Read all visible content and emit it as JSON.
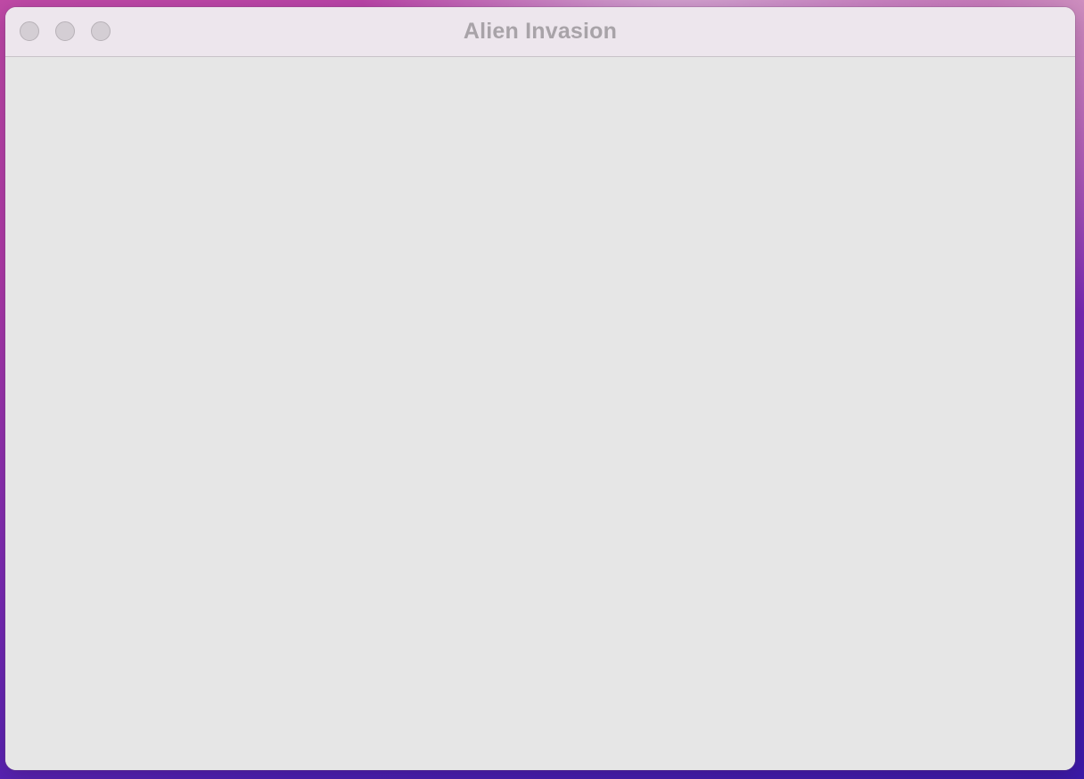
{
  "window": {
    "title": "Alien Invasion"
  },
  "titlebar": {
    "buttons": [
      {
        "name": "close",
        "icon": "close-icon"
      },
      {
        "name": "minimize",
        "icon": "minimize-icon"
      },
      {
        "name": "zoom",
        "icon": "zoom-icon"
      }
    ]
  },
  "colors": {
    "window_background": "#e6e6e6",
    "titlebar_background": "#ede6ed",
    "title_text": "#a8a3a8",
    "traffic_light_inactive": "#d4ced4"
  }
}
